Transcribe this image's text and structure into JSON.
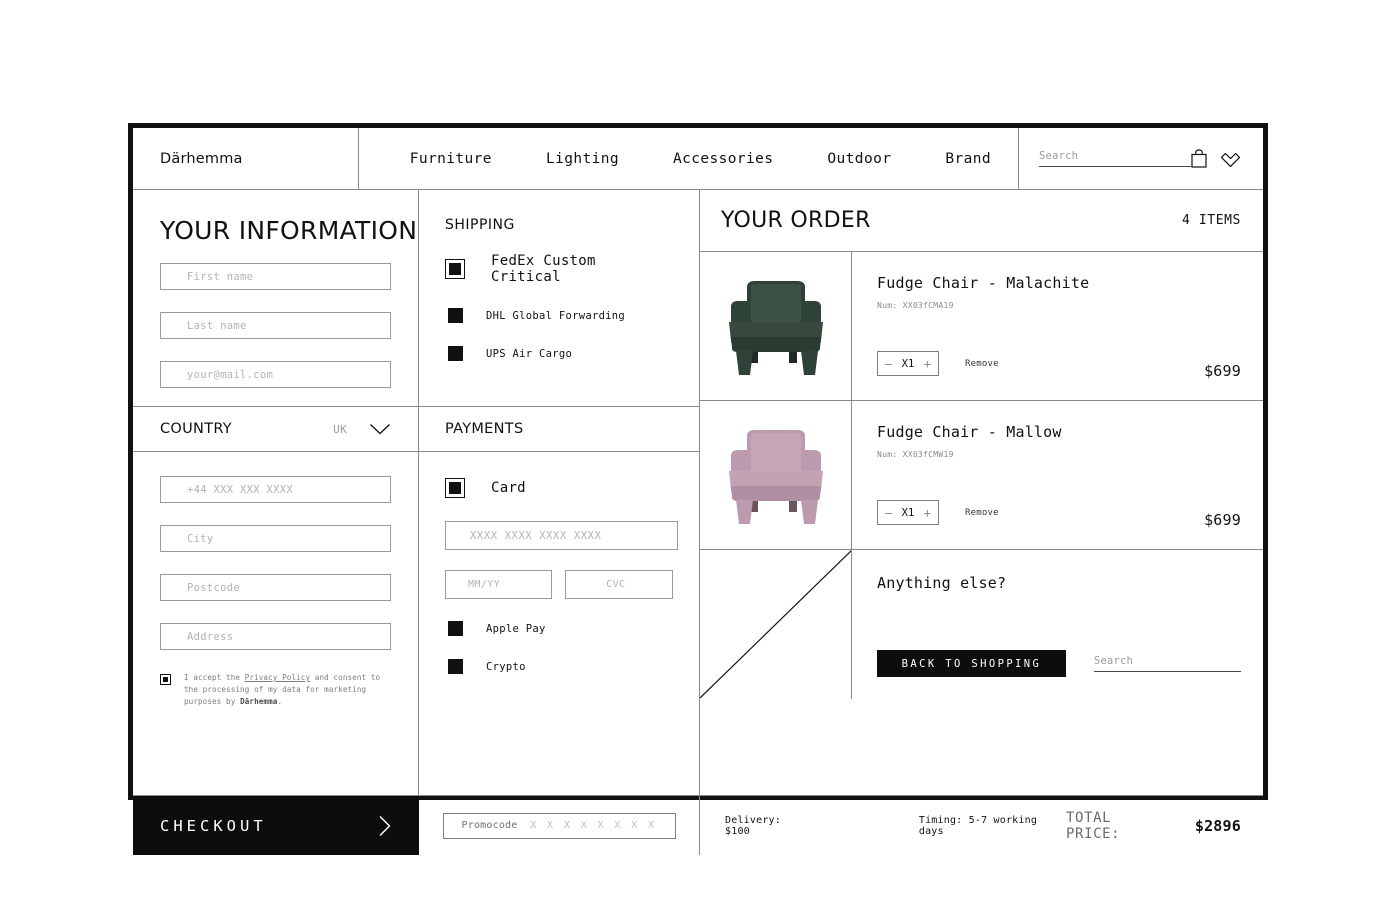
{
  "brand": {
    "name": "Därhemma"
  },
  "nav": {
    "links": [
      {
        "label": "Furniture"
      },
      {
        "label": "Lighting"
      },
      {
        "label": "Accessories"
      },
      {
        "label": "Outdoor"
      },
      {
        "label": "Brand"
      }
    ],
    "search_placeholder": "Search",
    "icons": [
      "bag-icon",
      "heart-icon"
    ]
  },
  "information": {
    "title": "YOUR INFORMATION",
    "fields": [
      {
        "name": "first-name",
        "placeholder": "First name",
        "value": ""
      },
      {
        "name": "last-name",
        "placeholder": "Last name",
        "value": ""
      },
      {
        "name": "email",
        "placeholder": "your@mail.com",
        "value": ""
      }
    ],
    "country": {
      "label": "COUNTRY",
      "value": "UK"
    },
    "fields2": [
      {
        "name": "phone",
        "placeholder": "+44 XXX XXX XXXX",
        "value": ""
      },
      {
        "name": "city",
        "placeholder": "City",
        "value": ""
      },
      {
        "name": "postcode",
        "placeholder": "Postcode",
        "value": ""
      },
      {
        "name": "address",
        "placeholder": "Address",
        "value": ""
      }
    ],
    "consent": {
      "part1": "I accept the ",
      "link": "Privacy Policy",
      "part2": " and consent to the processing of my data for marketing purposes by ",
      "brand": "Därhemma",
      "part3": ".",
      "checked": true
    }
  },
  "shipping": {
    "title": "SHIPPING",
    "options": [
      {
        "label": "FedEx Custom Critical",
        "selected": true
      },
      {
        "label": "DHL Global Forwarding",
        "selected": false
      },
      {
        "label": "UPS Air Cargo",
        "selected": false
      }
    ]
  },
  "payments": {
    "title": "PAYMENTS",
    "options": [
      {
        "label": "Card",
        "selected": true
      },
      {
        "label": "Apple Pay",
        "selected": false
      },
      {
        "label": "Crypto",
        "selected": false
      }
    ],
    "card_placeholder": "XXXX XXXX XXXX XXXX",
    "expiry_placeholder": "MM/YY",
    "cvc_placeholder": "CVC"
  },
  "order": {
    "title": "YOUR ORDER",
    "items_count": "4 ITEMS",
    "items": [
      {
        "name": "Fudge Chair - Malachite",
        "num_label": "Num: XX03fCMA19",
        "qty": "X1",
        "minus": "–",
        "plus": "+",
        "remove": "Remove",
        "price": "$699",
        "color": "#2f4237",
        "shadow": "#1d2a22"
      },
      {
        "name": "Fudge Chair - Mallow",
        "num_label": "Num: XX03fCMW19",
        "qty": "X1",
        "minus": "–",
        "plus": "+",
        "remove": "Remove",
        "price": "$699",
        "color": "#bd9bae",
        "shadow": "#a1819a"
      }
    ],
    "anything_else": {
      "title": "Anything else?",
      "back_button": "BACK TO SHOPPING",
      "search_placeholder": "Search"
    }
  },
  "footer": {
    "checkout_label": "CHECKOUT",
    "promocode_label": "Promocode",
    "promocode_mask": "X X X X X X X X",
    "delivery": "Delivery: $100",
    "timing": "Timing: 5-7 working days",
    "total_label": "TOTAL PRICE:",
    "total_value": "$2896"
  },
  "colors": {
    "ink": "#111111",
    "line": "#8a8a8a",
    "placeholder": "#b3b3b3",
    "black_fill": "#0d0d0d"
  }
}
